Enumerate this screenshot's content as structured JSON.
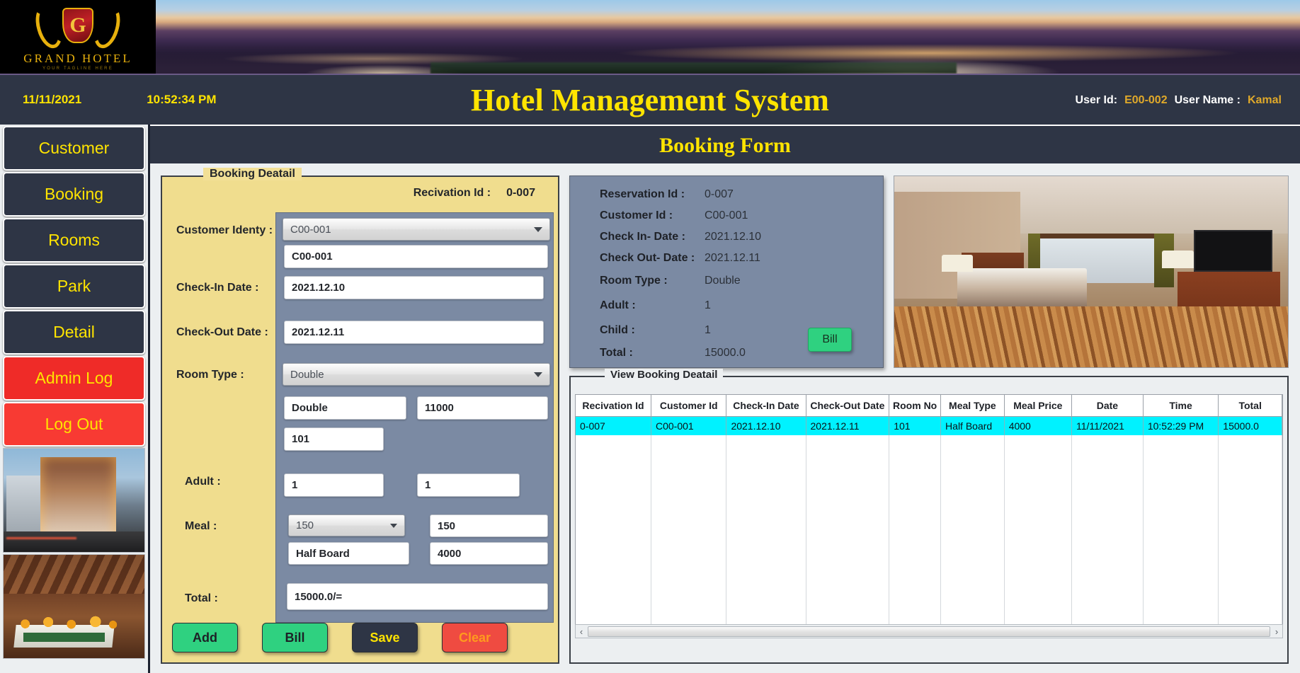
{
  "brand": {
    "logo_letter": "G",
    "logo_name": "GRAND HOTEL",
    "logo_tagline": "YOUR TAGLINE HERE"
  },
  "header": {
    "date": "11/11/2021",
    "time": "10:52:34 PM",
    "title": "Hotel Management System",
    "user_id_label": "User Id:",
    "user_id_value": "E00-002",
    "user_name_label": "User Name :",
    "user_name_value": "Kamal"
  },
  "page": {
    "subtitle": "Booking Form"
  },
  "sidebar": {
    "items": [
      {
        "label": "Customer",
        "style": "dark"
      },
      {
        "label": "Booking",
        "style": "dark"
      },
      {
        "label": "Rooms",
        "style": "dark"
      },
      {
        "label": "Park",
        "style": "dark"
      },
      {
        "label": "Detail",
        "style": "dark"
      },
      {
        "label": "Admin Log",
        "style": "danger"
      },
      {
        "label": "Log Out",
        "style": "danger2"
      }
    ]
  },
  "booking_form": {
    "legend": "Booking Deatail",
    "reservation_id_label": "Recivation Id :",
    "reservation_id_value": "0-007",
    "labels": {
      "customer_identity": "Customer Identy :",
      "check_in": "Check-In Date :",
      "check_out": "Check-Out Date :",
      "room_type": "Room Type :",
      "adult": "Adult :",
      "meal": "Meal :",
      "total": "Total :"
    },
    "fields": {
      "customer_combo": "C00-001",
      "customer_id": "C00-001",
      "check_in_date": "2021.12.10",
      "check_out_date": "2021.12.11",
      "room_type_combo": "Double",
      "room_type_text": "Double",
      "room_rate": "11000",
      "room_no": "101",
      "adult_count": "1",
      "child_count": "1",
      "meal_combo": "150",
      "meal_code": "150",
      "meal_type": "Half Board",
      "meal_price": "4000",
      "total": "15000.0/="
    },
    "buttons": [
      {
        "label": "Add",
        "style": "green"
      },
      {
        "label": "Bill",
        "style": "green"
      },
      {
        "label": "Save",
        "style": "dark"
      },
      {
        "label": "Clear",
        "style": "red"
      }
    ]
  },
  "summary": {
    "rows": [
      {
        "key": "Reservation Id :",
        "value": "0-007"
      },
      {
        "key": "Customer Id :",
        "value": "C00-001"
      },
      {
        "key": "Check In- Date :",
        "value": "2021.12.10"
      },
      {
        "key": "Check Out- Date :",
        "value": "2021.12.11"
      },
      {
        "key": "Room Type :",
        "value": "Double"
      },
      {
        "key": "Adult :",
        "value": "1"
      },
      {
        "key": "Child :",
        "value": "1"
      },
      {
        "key": "Total :",
        "value": "15000.0"
      }
    ],
    "bill_button": "Bill"
  },
  "booking_table": {
    "legend": "View Booking Deatail",
    "columns": [
      "Recivation Id",
      "Customer Id",
      "Check-In Date",
      "Check-Out Date",
      "Room No",
      "Meal Type",
      "Meal Price",
      "Date",
      "Time",
      "Total"
    ],
    "rows": [
      [
        "0-007",
        "C00-001",
        "2021.12.10",
        "2021.12.11",
        "101",
        "Half Board",
        "4000",
        "11/11/2021",
        "10:52:29 PM",
        "15000.0"
      ]
    ],
    "scroll_left_icon": "‹",
    "scroll_right_icon": "›"
  },
  "colors": {
    "accent_yellow": "#ffe400",
    "panel_blue": "#7b8aa3",
    "form_cream": "#f0dd8e",
    "row_highlight": "#00f2ff",
    "danger_red": "#ef2b28",
    "success_green": "#2fd180"
  }
}
